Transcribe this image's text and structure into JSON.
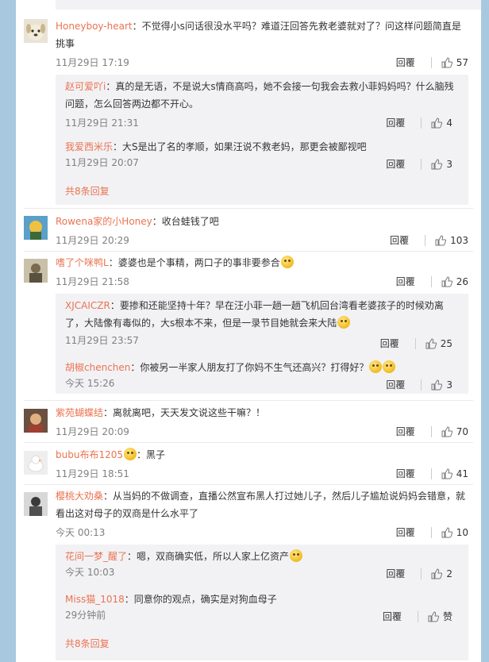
{
  "ops": {
    "reply": "回覆",
    "more_replies": "共8条回复"
  },
  "comments": [
    {
      "user": "Honeyboy-heart",
      "text": "：不觉得小s问话很没水平吗？难道汪回答先救老婆就对了？问这样问题简直是挑事",
      "time": "11月29日 17:19",
      "likes": "57",
      "replies": [
        {
          "user": "赵可爱吖i",
          "text": "：真的是无语，不是说大s情商高吗，她不会接一句我会去救小菲妈妈吗？什么脑残问题，怎么回答两边都不开心。",
          "time": "11月29日 21:31",
          "likes": "4"
        },
        {
          "user": "我爱西米乐",
          "text": "：大S是出了名的孝顺，如果汪说不救老妈，那更会被鄙视吧",
          "time": "11月29日 20:07",
          "likes": "3"
        }
      ]
    },
    {
      "user": "Rowena家的小Honey",
      "text": "：收台蛙钱了吧",
      "time": "11月29日 20:29",
      "likes": "103"
    },
    {
      "user": "嗜了个咪鸭L",
      "text": "：婆婆也是个事精，两口子的事非要参合",
      "time": "11月29日 21:58",
      "likes": "26",
      "replies": [
        {
          "user": "XJCAICZR",
          "text": "：要掺和还能坚持十年？早在汪小菲一趟一趟飞机回台湾看老婆孩子的时候劝离了，大陆像有毒似的，大s根本不来，但是一录节目她就会来大陆",
          "time": "11月29日 23:57",
          "likes": "25"
        },
        {
          "user": "胡椒chenchen",
          "text": "：你被另一半家人朋友打了你妈不生气还高兴？打得好？",
          "time": "今天 15:26",
          "likes": "3"
        }
      ]
    },
    {
      "user": "紫苑蝴蝶结",
      "text": "：离就离吧，天天发文说这些干嘛？！",
      "time": "11月29日 20:09",
      "likes": "70"
    },
    {
      "user": "bubu布布1205",
      "text": "：黑子",
      "time": "11月29日 18:51",
      "likes": "41"
    },
    {
      "user": "樱桃大劝桑",
      "text": "：从当妈的不做调查，直播公然宣布黑人打过她儿子，然后儿子尴尬说妈妈会错意，就看出这对母子的双商是什么水平了",
      "time": "今天 00:13",
      "likes": "10",
      "replies": [
        {
          "user": "花间一梦_醒了",
          "text": "：嗯，双商确实低，所以人家上亿资产",
          "time": "今天 10:03",
          "likes": "2"
        },
        {
          "user": "Miss猫_1018",
          "text": "：同意你的观点，确实是对狗血母子",
          "time": "29分钟前",
          "likes": "赞"
        }
      ]
    }
  ],
  "colors": {
    "username": "#eb7350",
    "reply_bg": "#f2f2f5",
    "page_bg": "#a8c8e0"
  }
}
